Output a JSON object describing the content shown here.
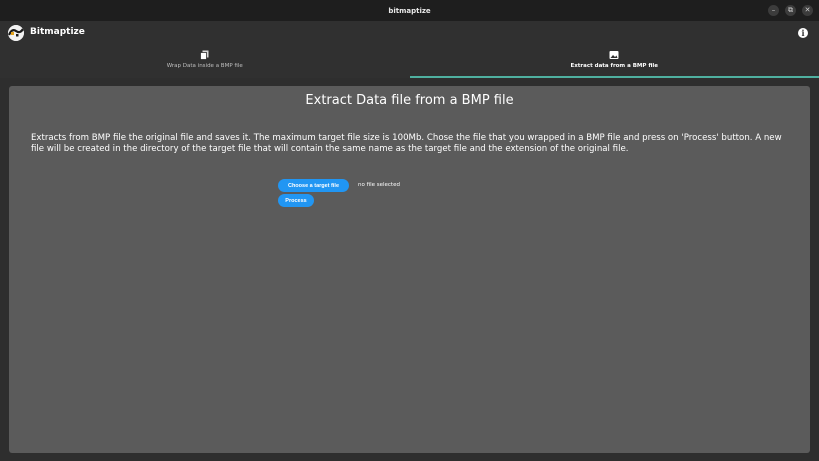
{
  "window": {
    "title": "bitmaptize",
    "controls": {
      "minimize": "–",
      "restore": "⧉",
      "close": "✕"
    }
  },
  "app": {
    "name": "Bitmaptize",
    "info_glyph": "i"
  },
  "tabs": [
    {
      "label": "Wrap Data inside a BMP file",
      "icon": "copy-file-icon",
      "active": false
    },
    {
      "label": "Extract data from a BMP file",
      "icon": "image-icon",
      "active": true
    }
  ],
  "main": {
    "title": "Extract Data file from a BMP file",
    "description": "Extracts from BMP file the original file and saves it. The maximum target file size is 100Mb. Chose the file that you wrapped in a BMP file and press on 'Process' button. A new file will be created in the directory of the target file that will contain the same name as the target file and the extension of the original file.",
    "choose_button": "Choose a target file",
    "file_status": "no file selected",
    "process_button": "Process"
  },
  "colors": {
    "accent_tab": "#4fb0a0",
    "button": "#2196f3",
    "panel": "#5b5b5b"
  }
}
